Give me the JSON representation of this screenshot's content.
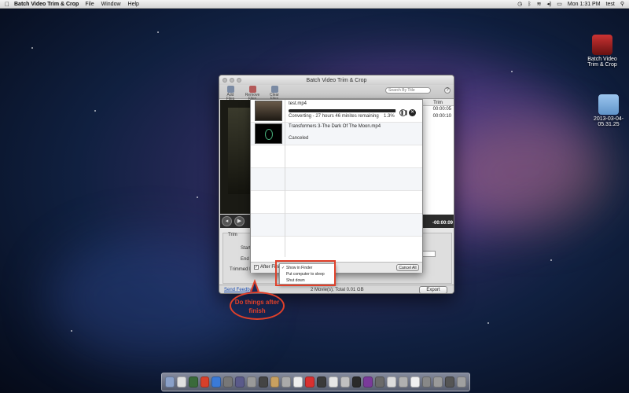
{
  "menubar": {
    "app_name": "Batch Video Trim & Crop",
    "menus": [
      "File",
      "Window",
      "Help"
    ],
    "clock": "Mon 1:31 PM",
    "user": "test"
  },
  "desktop_icons": [
    {
      "label": "Batch Video\nTrim & Crop",
      "icon": "app-icon"
    },
    {
      "label": "2013-03-04-\n05.31.25",
      "icon": "folder-icon"
    }
  ],
  "window": {
    "title": "Batch Video Trim & Crop",
    "toolbar": {
      "add_files": "Add Files",
      "remove_files": "Remove Files",
      "clear_files": "Clear Files",
      "search_placeholder": "Search By Title",
      "search_caption": "Search",
      "help": "?"
    },
    "table": {
      "trim_header": "Trim",
      "trim_values": [
        "00:00:05",
        "00:00:10"
      ]
    },
    "player": {
      "end_time": "-00:00:09"
    },
    "trim_panel": {
      "legend": "Trim",
      "start_label": "Start Ti",
      "end_label": "End Tr",
      "length_label": "Trimmed Len"
    },
    "status": {
      "feedback": "Send Feedback",
      "summary": "2 Movie(s), Total 0.01 GB",
      "export": "Export"
    }
  },
  "conversion": {
    "items": [
      {
        "file": "test.mp4",
        "status": "Converting - 27 hours 46 minites remaining",
        "percent": "1.3%",
        "progress": 0.99
      },
      {
        "file": "Transformers 3-The Dark Of The Moon.mp4",
        "status": "Canceled"
      }
    ],
    "after_finish_label": "After Finish",
    "cancel_all": "Cancel All",
    "options": [
      "Show in Finder",
      "Put computer to sleep",
      "Shut down"
    ],
    "selected_option": "Show in Finder"
  },
  "annotation": {
    "callout": "Do things after finish",
    "color": "#e0402a"
  }
}
